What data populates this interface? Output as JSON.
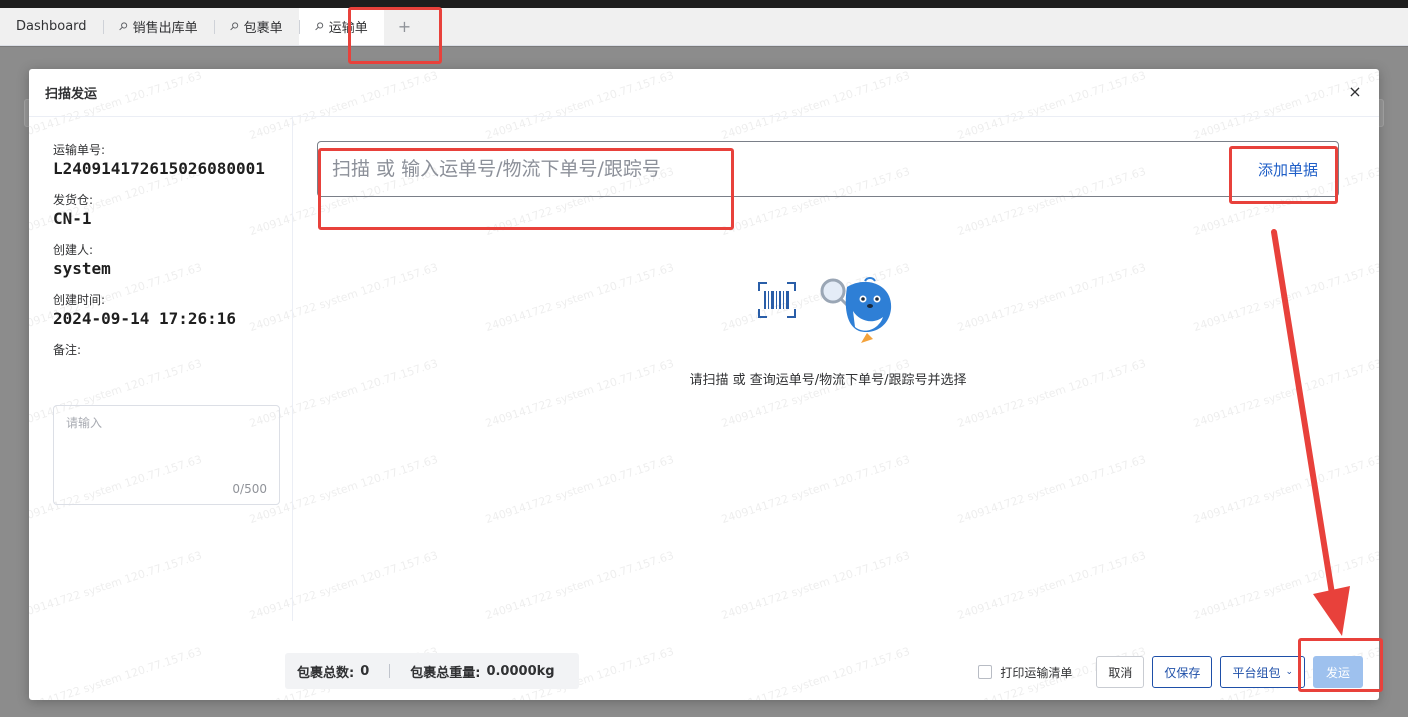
{
  "tabs": [
    {
      "label": "Dashboard",
      "pinned": false,
      "active": false
    },
    {
      "label": "销售出库单",
      "pinned": true,
      "active": false
    },
    {
      "label": "包裹单",
      "pinned": true,
      "active": false
    },
    {
      "label": "运输单",
      "pinned": true,
      "active": true
    }
  ],
  "tab_add_symbol": "+",
  "modal": {
    "title": "扫描发运",
    "close_symbol": "×"
  },
  "info": {
    "transport_no_label": "运输单号:",
    "transport_no": "L240914172615026080001",
    "warehouse_label": "发货仓:",
    "warehouse": "CN-1",
    "creator_label": "创建人:",
    "creator": "system",
    "created_time_label": "创建时间:",
    "created_time": "2024-09-14 17:26:16",
    "remark_label": "备注:",
    "remark_placeholder": "请输入",
    "remark_count": "0/500"
  },
  "scan": {
    "placeholder": "扫描 或 输入运单号/物流下单号/跟踪号",
    "add_button": "添加单据"
  },
  "empty_state": {
    "text": "请扫描 或 查询运单号/物流下单号/跟踪号并选择",
    "icon": "barcode-scan-whale-illustration"
  },
  "summary": {
    "total_packages_label": "包裹总数:",
    "total_packages": "0",
    "total_weight_label": "包裹总重量:",
    "total_weight": "0.0000kg"
  },
  "actions": {
    "print_checkbox_label": "打印运输清单",
    "print_checked": false,
    "cancel": "取消",
    "save_only": "仅保存",
    "platform_pack": "平台组包",
    "ship": "发运"
  },
  "watermark_text": "2409141722 system 120.77.157.63",
  "colors": {
    "primary": "#1e4fa8",
    "link": "#1e5ec7",
    "disabled_primary": "#9ec1ee",
    "annotation": "#e8413b"
  }
}
